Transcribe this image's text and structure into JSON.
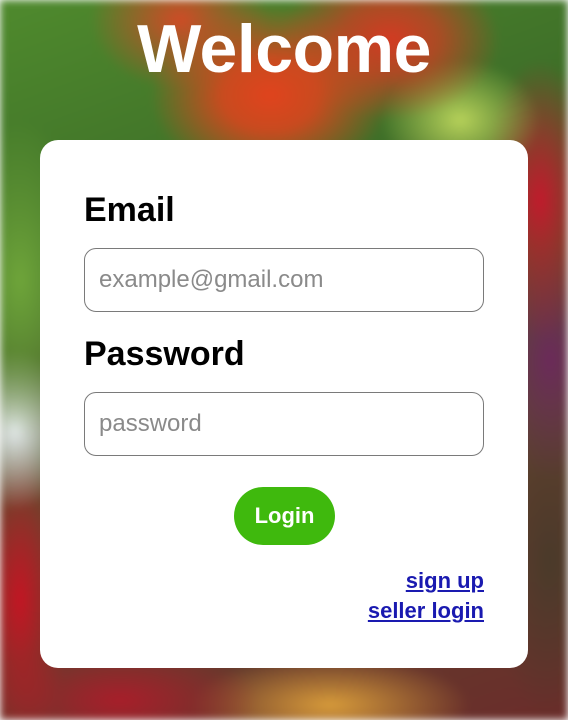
{
  "header": {
    "title": "Welcome"
  },
  "form": {
    "email_label": "Email",
    "email_placeholder": "example@gmail.com",
    "password_label": "Password",
    "password_placeholder": "password",
    "login_label": "Login"
  },
  "links": {
    "signup_label": "sign up",
    "seller_login_label": "seller login"
  },
  "colors": {
    "login_button": "#3fb90d",
    "link": "#1a1ab0",
    "card": "#ffffff"
  }
}
